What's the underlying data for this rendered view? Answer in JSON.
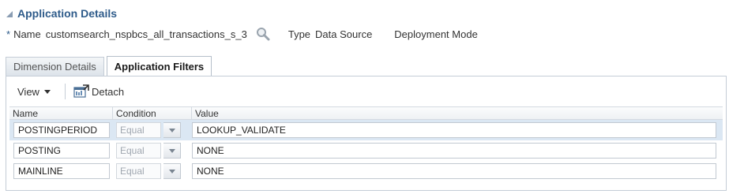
{
  "section": {
    "title": "Application Details"
  },
  "meta": {
    "required_marker": "*",
    "name_label": "Name",
    "name_value": "customsearch_nspbcs_all_transactions_s_3",
    "type_label": "Type",
    "type_value": "Data Source",
    "deployment_label": "Deployment Mode"
  },
  "tabs": [
    {
      "label": "Dimension Details",
      "active": false
    },
    {
      "label": "Application Filters",
      "active": true
    }
  ],
  "toolbar": {
    "view_label": "View",
    "detach_label": "Detach"
  },
  "table": {
    "columns": [
      "Name",
      "Condition",
      "Value"
    ],
    "rows": [
      {
        "name": "POSTINGPERIOD",
        "condition": "Equal",
        "value": "LOOKUP_VALIDATE",
        "selected": true
      },
      {
        "name": "POSTING",
        "condition": "Equal",
        "value": "NONE",
        "selected": false
      },
      {
        "name": "MAINLINE",
        "condition": "Equal",
        "value": "NONE",
        "selected": false
      }
    ]
  },
  "colors": {
    "title": "#2e5b8a",
    "selected_row": "#dbe7f3",
    "border": "#c4ccd6"
  },
  "icons": {
    "collapse": "collapse-triangle-icon",
    "search": "magnifier-icon",
    "detach": "detach-window-icon",
    "dropdown": "chevron-down-icon"
  }
}
